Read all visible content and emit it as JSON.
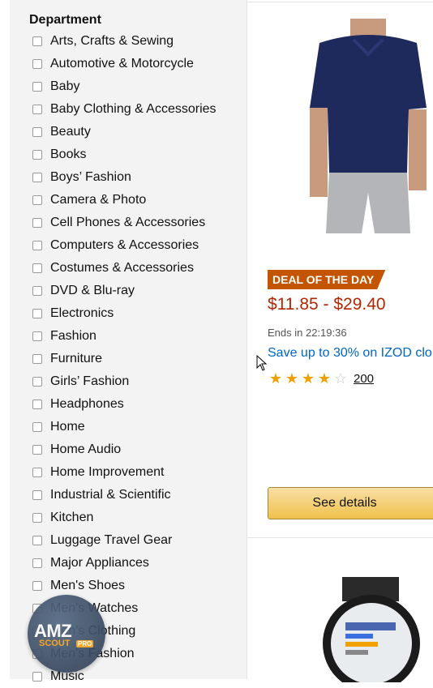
{
  "sidebar": {
    "title": "Department",
    "items": [
      "Arts, Crafts & Sewing",
      "Automotive & Motorcycle",
      "Baby",
      "Baby Clothing & Accessories",
      "Beauty",
      "Books",
      "Boys’ Fashion",
      "Camera & Photo",
      "Cell Phones & Accessories",
      "Computers & Accessories",
      "Costumes & Accessories",
      "DVD & Blu-ray",
      "Electronics",
      "Fashion",
      "Furniture",
      "Girls’ Fashion",
      "Headphones",
      "Home",
      "Home Audio",
      "Home Improvement",
      "Industrial & Scientific",
      "Kitchen",
      "Luggage Travel Gear",
      "Major Appliances",
      "Men's Shoes",
      "Men's Watches",
      "Men's Clothing",
      "Men's Fashion",
      "Music"
    ]
  },
  "deal": {
    "badge": "DEAL OF THE DAY",
    "price": "$11.85 - $29.40",
    "ends": "Ends in 22:19:36",
    "link": "Save up to 30% on IZOD clo",
    "rating": 4,
    "rating_max": 5,
    "review_count": "200",
    "button": "See details"
  },
  "extension": {
    "logo": "AMZ",
    "sub": "SCOUT",
    "tier": "PRO"
  },
  "colors": {
    "sidebar_bg": "#f3f3f3",
    "deal_badge": "#c45500",
    "price": "#b12704",
    "link": "#0066c0",
    "star": "#f0a100",
    "button": "#f0c14b"
  }
}
